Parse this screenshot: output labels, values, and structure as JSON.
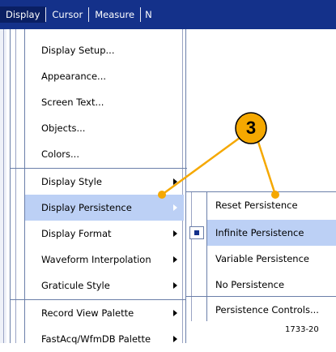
{
  "menubar": {
    "items": [
      {
        "label": "Display",
        "active": true
      },
      {
        "label": "Cursor",
        "active": false
      },
      {
        "label": "Measure",
        "active": false
      },
      {
        "label": "N",
        "active": false
      }
    ],
    "background": "#14318a"
  },
  "display_menu": {
    "group1": [
      {
        "pre": "D",
        "mid": "isplay Setup...",
        "post": ""
      },
      {
        "pre": "",
        "u": "A",
        "post": "ppearance..."
      },
      {
        "pre": "",
        "u": "S",
        "post": "creen Text..."
      },
      {
        "pre": "",
        "u": "O",
        "post": "bjects..."
      },
      {
        "pre": "",
        "u": "C",
        "post": "olors..."
      }
    ],
    "group2": [
      {
        "label": "Display Style",
        "has_submenu": true
      },
      {
        "label": "Display Persistence",
        "has_submenu": true,
        "highlighted": true
      },
      {
        "label": "Display Format",
        "has_submenu": true
      },
      {
        "label": "Waveform Interpolation",
        "has_submenu": true
      },
      {
        "label": "Graticule Style",
        "has_submenu": true
      }
    ],
    "group3": [
      {
        "label": "Record View Palette",
        "has_submenu": true
      },
      {
        "label": "FastAcq/WfmDB Palette",
        "has_submenu": true
      }
    ]
  },
  "persistence_submenu": {
    "items": [
      {
        "label": "Reset Persistence",
        "checked": false
      },
      {
        "label": "Infinite Persistence",
        "checked": true,
        "highlighted": true
      },
      {
        "label": "Variable Persistence",
        "checked": false
      },
      {
        "label": "No Persistence",
        "checked": false
      },
      {
        "label": "Persistence Controls...",
        "checked": false
      }
    ]
  },
  "labels": {
    "display_setup": "Display Setup...",
    "appearance": "Appearance...",
    "screen_text": "Screen Text...",
    "objects": "Objects...",
    "colors": "Colors...",
    "display_style": "Display Style",
    "display_persistence": "Display Persistence",
    "display_format": "Display Format",
    "waveform_interpolation": "Waveform Interpolation",
    "graticule_style": "Graticule Style",
    "record_view_palette": "Record View Palette",
    "fastacq_palette": "FastAcq/WfmDB Palette",
    "reset_persistence": "Reset Persistence",
    "infinite_persistence": "Infinite Persistence",
    "variable_persistence": "Variable Persistence",
    "no_persistence": "No Persistence",
    "persistence_controls": "Persistence Controls..."
  },
  "callout": {
    "number": "3",
    "color": "#f5a800"
  },
  "figure_id": "1733-20"
}
